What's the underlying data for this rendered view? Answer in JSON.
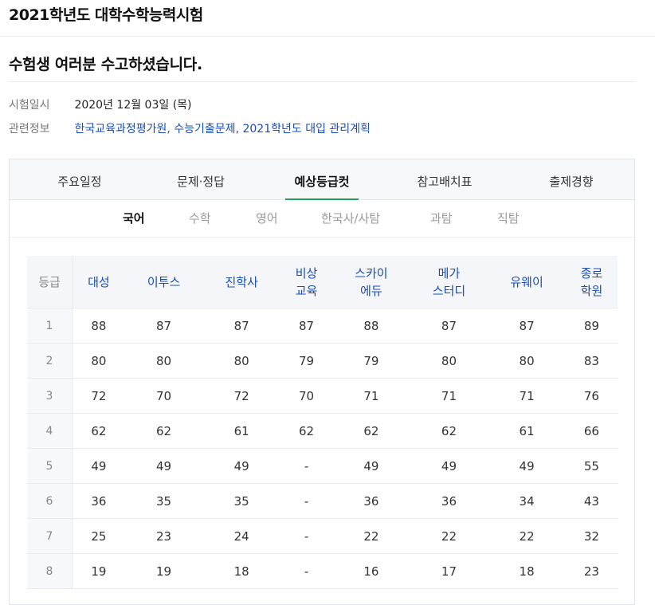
{
  "header": {
    "title": "2021학년도 대학수학능력시험"
  },
  "headline": "수험생 여러분 수고하셨습니다.",
  "info": {
    "date_label": "시험일시",
    "date_value": "2020년 12월 03일 (목)",
    "related_label": "관련정보",
    "links": [
      "한국교육과정평가원",
      "수능기출문제",
      "2021학년도 대입 관리계획"
    ]
  },
  "tabs": [
    {
      "label": "주요일정",
      "active": false
    },
    {
      "label": "문제·정답",
      "active": false
    },
    {
      "label": "예상등급컷",
      "active": true
    },
    {
      "label": "참고배치표",
      "active": false
    },
    {
      "label": "출제경향",
      "active": false
    }
  ],
  "subtabs": [
    {
      "label": "국어",
      "active": true
    },
    {
      "label": "수학",
      "active": false
    },
    {
      "label": "영어",
      "active": false
    },
    {
      "label": "한국사/사탐",
      "active": false
    },
    {
      "label": "과탐",
      "active": false
    },
    {
      "label": "직탐",
      "active": false
    }
  ],
  "table": {
    "header_first": "등급",
    "columns": [
      [
        "대성"
      ],
      [
        "이투스"
      ],
      [
        "진학사"
      ],
      [
        "비상",
        "교육"
      ],
      [
        "스카이",
        "에듀"
      ],
      [
        "메가",
        "스터디"
      ],
      [
        "유웨이"
      ],
      [
        "종로",
        "학원"
      ]
    ],
    "rows": [
      {
        "grade": "1",
        "values": [
          "88",
          "87",
          "87",
          "87",
          "88",
          "87",
          "87",
          "89"
        ]
      },
      {
        "grade": "2",
        "values": [
          "80",
          "80",
          "80",
          "79",
          "79",
          "80",
          "80",
          "83"
        ]
      },
      {
        "grade": "3",
        "values": [
          "72",
          "70",
          "72",
          "70",
          "71",
          "71",
          "71",
          "76"
        ]
      },
      {
        "grade": "4",
        "values": [
          "62",
          "62",
          "61",
          "62",
          "62",
          "62",
          "61",
          "66"
        ]
      },
      {
        "grade": "5",
        "values": [
          "49",
          "49",
          "49",
          "-",
          "49",
          "49",
          "49",
          "55"
        ]
      },
      {
        "grade": "6",
        "values": [
          "36",
          "35",
          "35",
          "-",
          "36",
          "36",
          "34",
          "43"
        ]
      },
      {
        "grade": "7",
        "values": [
          "25",
          "23",
          "24",
          "-",
          "22",
          "22",
          "22",
          "32"
        ]
      },
      {
        "grade": "8",
        "values": [
          "19",
          "19",
          "18",
          "-",
          "16",
          "17",
          "18",
          "23"
        ]
      }
    ]
  }
}
